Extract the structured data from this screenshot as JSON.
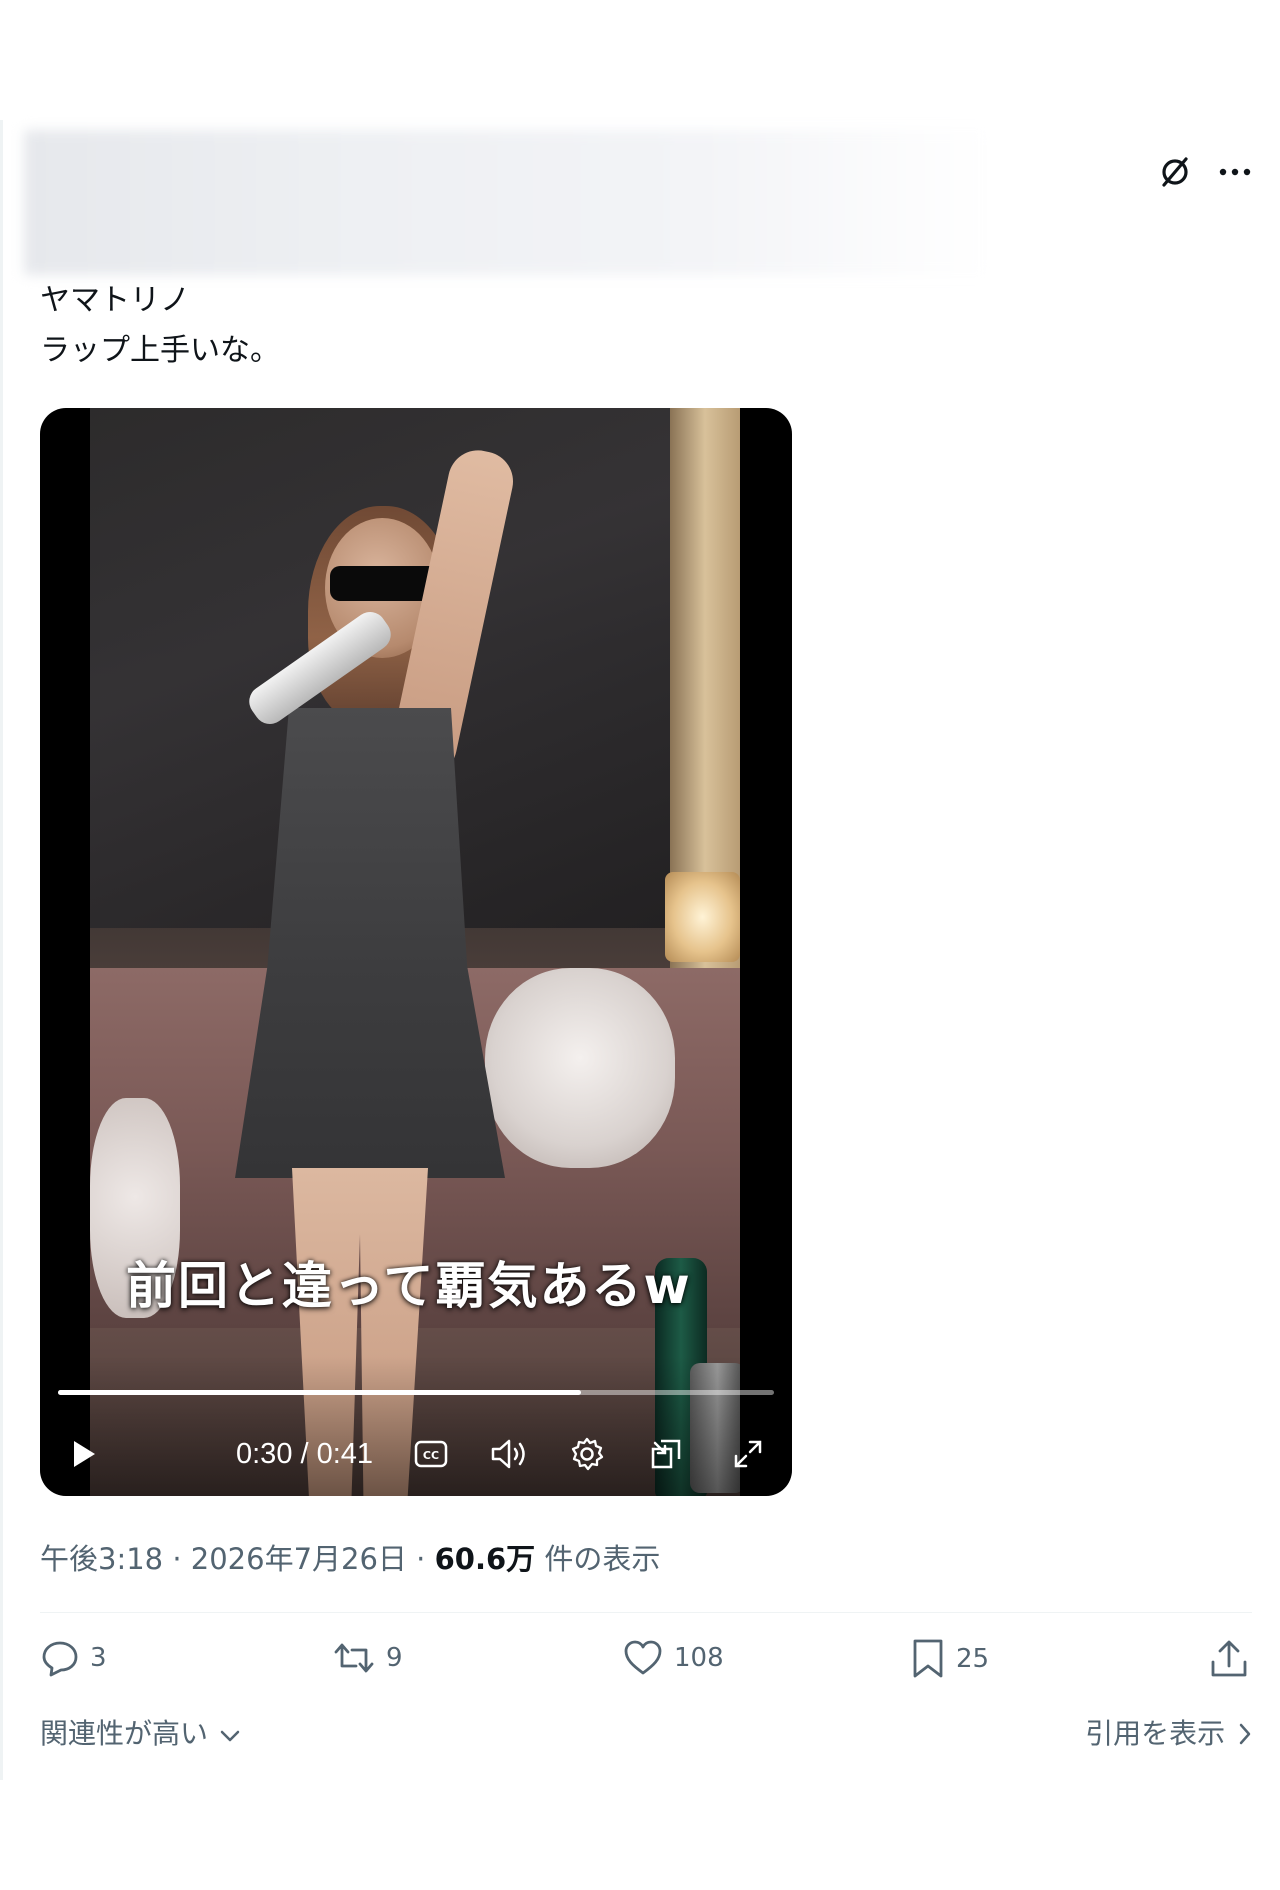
{
  "tweet": {
    "text_line1": "ヤマトリノ",
    "text_line2": "ラップ上手いな。"
  },
  "video": {
    "caption": "前回と違って覇気あるw",
    "time": "0:30 / 0:41",
    "progress": 0.73,
    "controls": [
      "play-icon",
      "cc-icon",
      "volume-icon",
      "settings-icon",
      "pip-icon",
      "fullscreen-icon"
    ]
  },
  "meta": {
    "time": "午後3:18",
    "sep1": " · ",
    "date": "2026年7月26日",
    "sep2": " · ",
    "views": "60.6万",
    "views_label": " 件の表示"
  },
  "actions": {
    "reply_count": "3",
    "retweet_count": "9",
    "like_count": "108",
    "bookmark_count": "25"
  },
  "footer": {
    "sort_label": "関連性が高い",
    "quotes_label": "引用を表示"
  },
  "icons": {
    "top": [
      "grok-icon",
      "more-icon"
    ],
    "actions": [
      "reply-icon",
      "retweet-icon",
      "like-icon",
      "bookmark-icon",
      "share-icon"
    ]
  }
}
